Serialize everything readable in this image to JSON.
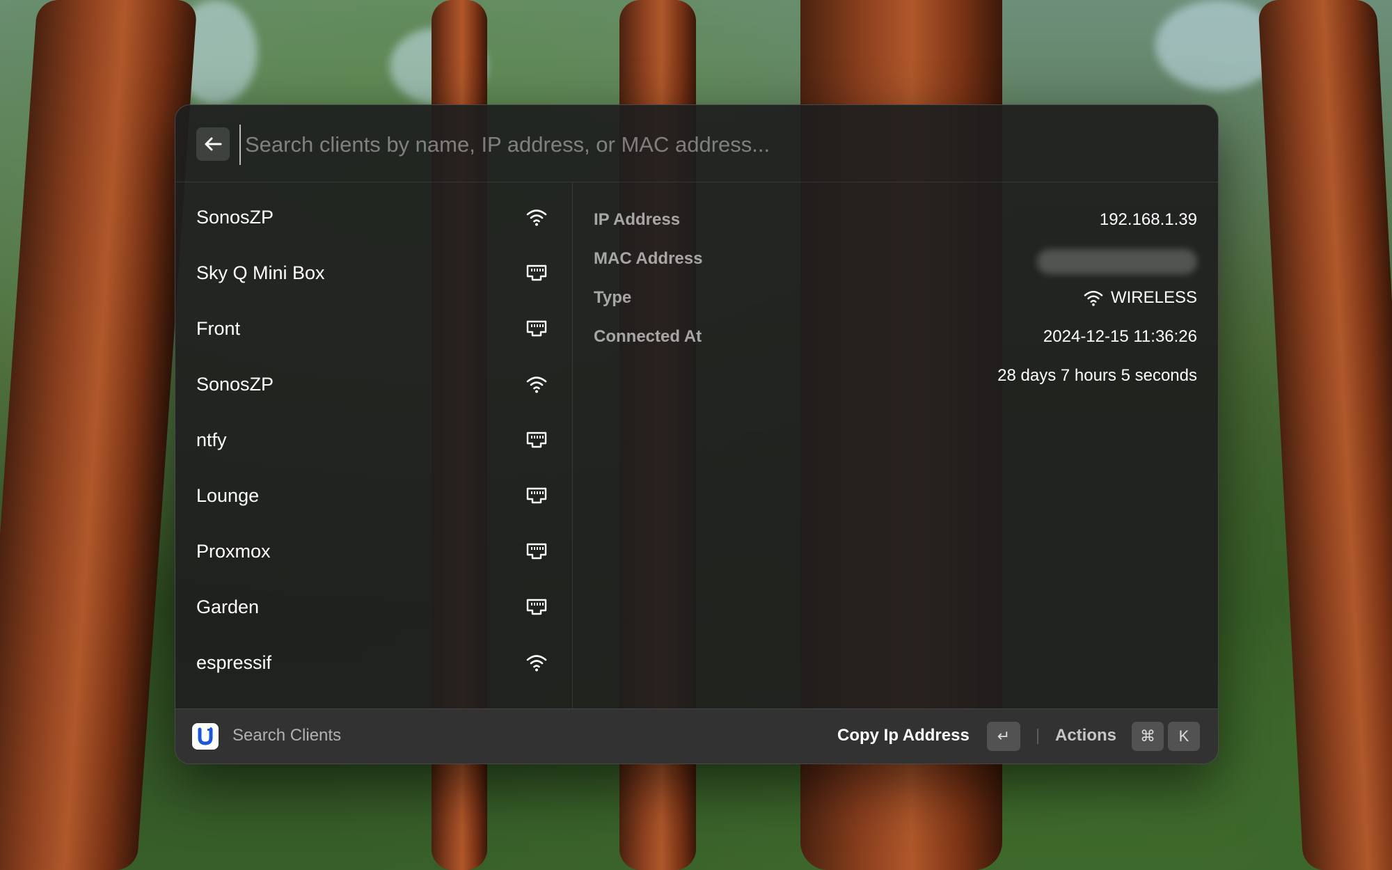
{
  "search": {
    "placeholder": "Search clients by name, IP address, or MAC address...",
    "value": ""
  },
  "clients": [
    {
      "name": "SonosZP",
      "icon": "wifi-icon",
      "selected": true
    },
    {
      "name": "Sky Q Mini Box",
      "icon": "ethernet-icon"
    },
    {
      "name": "Front",
      "icon": "ethernet-icon"
    },
    {
      "name": "SonosZP",
      "icon": "wifi-icon"
    },
    {
      "name": "ntfy",
      "icon": "ethernet-icon"
    },
    {
      "name": "Lounge",
      "icon": "ethernet-icon"
    },
    {
      "name": "Proxmox",
      "icon": "ethernet-icon"
    },
    {
      "name": "Garden",
      "icon": "ethernet-icon"
    },
    {
      "name": "espressif",
      "icon": "wifi-icon"
    }
  ],
  "detail": {
    "ip_label": "IP Address",
    "ip_value": "192.168.1.39",
    "mac_label": "MAC Address",
    "type_label": "Type",
    "type_value": "WIRELESS",
    "connected_label": "Connected At",
    "connected_value": "2024-12-15 11:36:26",
    "uptime_value": "28 days 7 hours 5 seconds"
  },
  "footer": {
    "title": "Search Clients",
    "primary_action": "Copy Ip Address",
    "enter_key": "↵",
    "actions_label": "Actions",
    "cmd_key": "⌘",
    "k_key": "K"
  },
  "colors": {
    "window_bg": "#1e1e1e",
    "logo_blue": "#1a56db",
    "text_primary": "#ffffff"
  }
}
